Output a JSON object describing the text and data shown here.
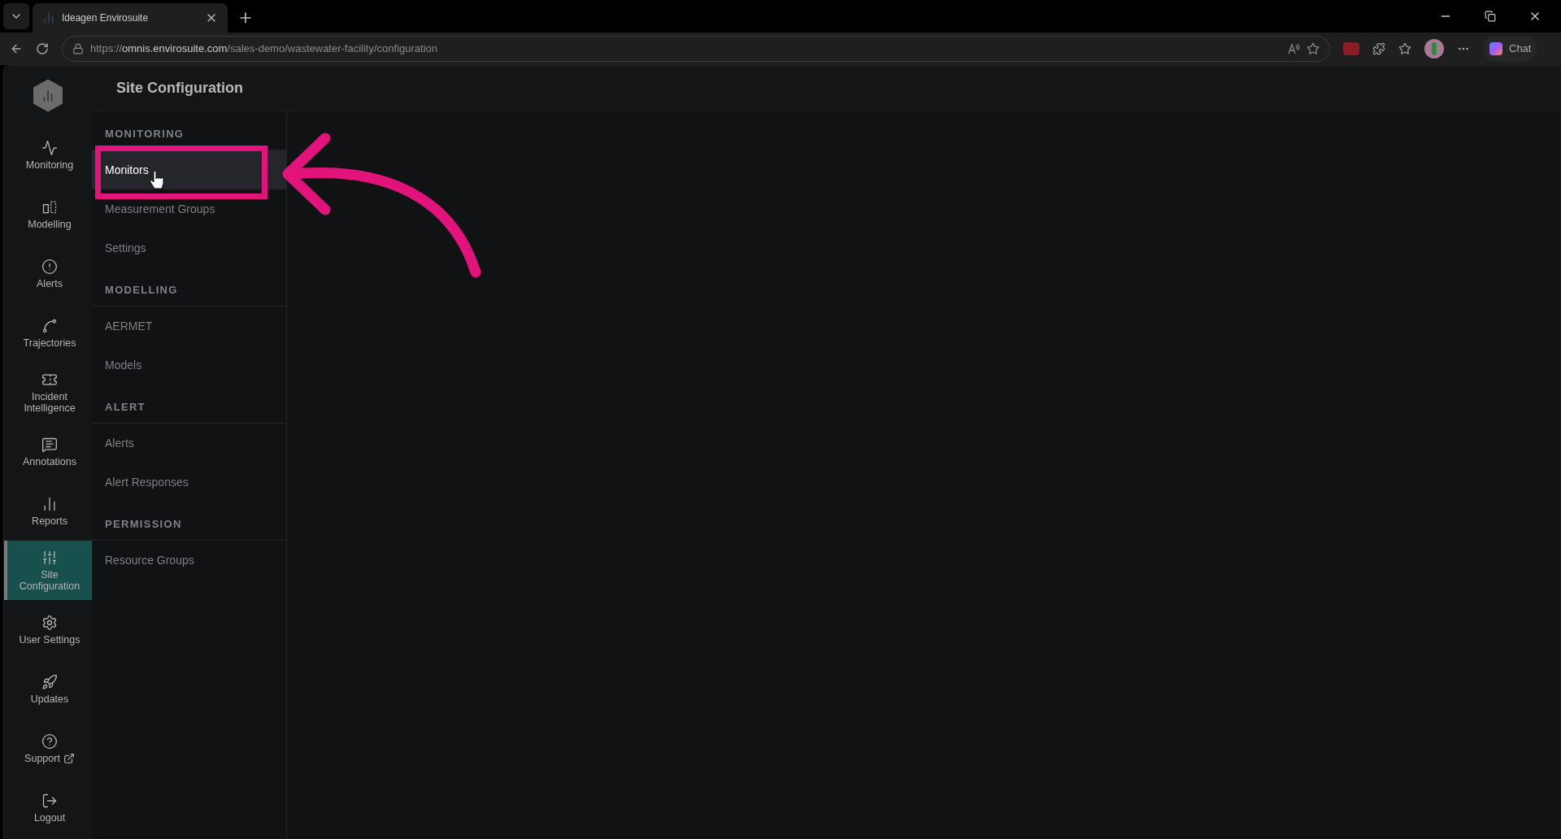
{
  "browser": {
    "tabs": [
      {
        "title": "Ideagen Envirosuite",
        "selected": true
      }
    ],
    "url": {
      "scheme": "https://",
      "host": "omnis.envirosuite.com",
      "path": "/sales-demo/wastewater-facility/configuration"
    },
    "chat_label": "Chat"
  },
  "sidebar": {
    "items": [
      {
        "label": "Monitoring",
        "selected": false
      },
      {
        "label": "Modelling",
        "selected": false
      },
      {
        "label": "Alerts",
        "selected": false
      },
      {
        "label": "Trajectories",
        "selected": false
      },
      {
        "label": "Incident Intelligence",
        "selected": false
      },
      {
        "label": "Annotations",
        "selected": false
      },
      {
        "label": "Reports",
        "selected": false
      },
      {
        "label": "Site Configuration",
        "selected": true
      },
      {
        "label": "User Settings",
        "selected": false
      },
      {
        "label": "Updates",
        "selected": false
      },
      {
        "label": "Support",
        "selected": false,
        "external": true
      },
      {
        "label": "Logout",
        "selected": false
      }
    ]
  },
  "page": {
    "title": "Site Configuration"
  },
  "config_menu": {
    "sections": [
      {
        "heading": "MONITORING",
        "items": [
          {
            "label": "Monitors",
            "selected": true
          },
          {
            "label": "Measurement Groups",
            "selected": false
          },
          {
            "label": "Settings",
            "selected": false
          }
        ]
      },
      {
        "heading": "MODELLING",
        "items": [
          {
            "label": "AERMET",
            "selected": false
          },
          {
            "label": "Models",
            "selected": false
          }
        ]
      },
      {
        "heading": "ALERT",
        "items": [
          {
            "label": "Alerts",
            "selected": false
          },
          {
            "label": "Alert Responses",
            "selected": false
          }
        ]
      },
      {
        "heading": "PERMISSION",
        "items": [
          {
            "label": "Resource Groups",
            "selected": false
          }
        ]
      }
    ]
  }
}
